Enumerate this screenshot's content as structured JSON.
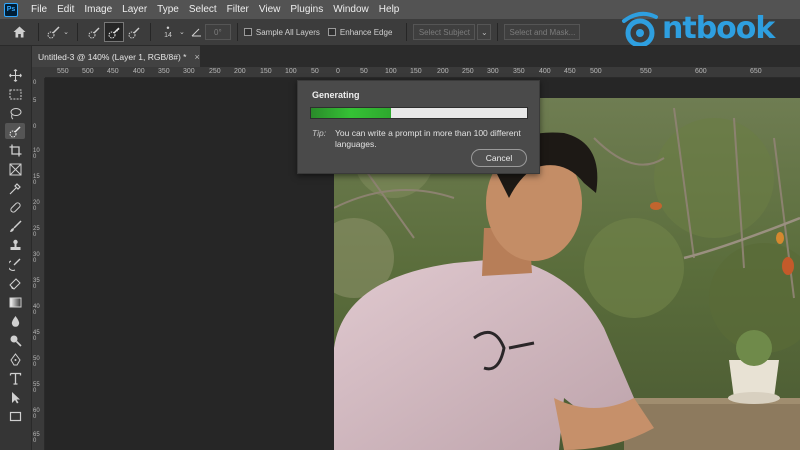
{
  "app": {
    "logo": "Ps"
  },
  "menu": [
    "File",
    "Edit",
    "Image",
    "Layer",
    "Type",
    "Select",
    "Filter",
    "View",
    "Plugins",
    "Window",
    "Help"
  ],
  "options": {
    "brush_size": "14",
    "angle_value": "0°",
    "sample_all_layers": "Sample All Layers",
    "enhance_edge": "Enhance Edge",
    "select_subject": "Select Subject",
    "select_and_mask": "Select and Mask..."
  },
  "brand": {
    "name": "ntbook"
  },
  "document": {
    "tab_title": "Untitled-3 @ 140% (Layer 1, RGB/8#) *"
  },
  "ruler": {
    "h": [
      "550",
      "500",
      "450",
      "400",
      "350",
      "300",
      "250",
      "200",
      "150",
      "100",
      "50",
      "0",
      "50",
      "100",
      "150",
      "200",
      "250",
      "300",
      "350",
      "400",
      "450",
      "500",
      "550",
      "600",
      "650"
    ],
    "v": [
      "0",
      "5",
      "0",
      "100",
      "150",
      "200",
      "250",
      "300",
      "350",
      "400",
      "450",
      "500",
      "550",
      "600",
      "650"
    ]
  },
  "dialog": {
    "title": "Generating",
    "progress": 0.37,
    "tip_label": "Tip:",
    "tip_text": "You can write a prompt in more than 100 different languages.",
    "cancel_label": "Cancel"
  },
  "colors": {
    "accent": "#31a8ff",
    "progress": "#35c335",
    "brand": "#2e9fe0"
  }
}
